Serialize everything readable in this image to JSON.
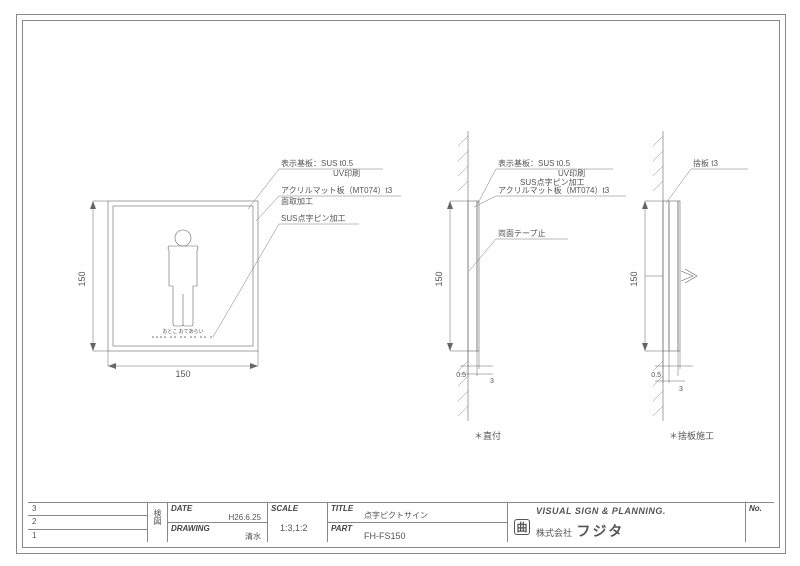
{
  "domain": "Diagram",
  "title_block": {
    "date_label": "DATE",
    "date_value": "H26.6.25",
    "drawing_label": "DRAWING",
    "drawing_value": "清水",
    "scale_label": "SCALE",
    "scale_value": "1:3,1:2",
    "title_label": "TITLE",
    "title_value": "点字ピクトサイン",
    "part_label": "PART",
    "part_value": "FH-FS150",
    "visual_line": "VISUAL  SIGN & PLANNING.",
    "company_prefix": "株式会社",
    "company_name": "フジタ",
    "no_label": "No.",
    "check_label": "検図",
    "rev_rows": [
      "3",
      "2",
      "1"
    ]
  },
  "front": {
    "dim_w": "150",
    "dim_h": "150",
    "braille_caption": "おとこ おてあらい",
    "callouts": {
      "c1a": "表示基板：SUS  t0.5",
      "c1b": "UV印刷",
      "c2a": "アクリルマット板（MT074）t3",
      "c2b": "面取加工",
      "c3": "SUS点字ピン加工"
    }
  },
  "side1": {
    "label": "＊直付",
    "dim_h": "150",
    "dim_t1": "0.5",
    "dim_t2": "3",
    "callouts": {
      "c1a": "表示基板：SUS  t0.5",
      "c1b": "UV印刷",
      "c1c": "SUS点字ピン加工",
      "c2": "アクリルマット板（MT074）t3",
      "c3": "両面テープ止"
    }
  },
  "side2": {
    "label": "＊捨板施工",
    "dim_h": "150",
    "dim_t1": "0.5",
    "dim_t2": "3",
    "callout": "捨板  t3"
  },
  "chart_data": {
    "type": "table",
    "description": "Engineering drawing of braille pictogram sign plate FH-FS150",
    "views": [
      {
        "name": "front",
        "width_mm": 150,
        "height_mm": 150
      },
      {
        "name": "side_direct_mount",
        "panel_t_mm": 0.5,
        "acrylic_t_mm": 3,
        "height_mm": 150
      },
      {
        "name": "side_backer_plate",
        "panel_t_mm": 0.5,
        "acrylic_t_mm": 3,
        "backer_t_mm": 3,
        "height_mm": 150
      }
    ],
    "materials": [
      "SUS t0.5 UV印刷",
      "アクリルマット板 MT074 t3 面取加工",
      "SUS点字ピン加工",
      "両面テープ止",
      "捨板 t3"
    ],
    "scales": [
      "1:3",
      "1:2"
    ],
    "date": "H26.6.25",
    "drawn_by": "清水"
  }
}
